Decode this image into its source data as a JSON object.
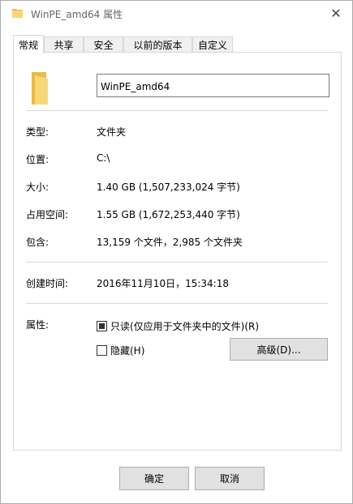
{
  "window": {
    "title": "WinPE_amd64 属性",
    "close_glyph": "✕"
  },
  "tabs": [
    {
      "label": "常规",
      "active": true
    },
    {
      "label": "共享",
      "active": false
    },
    {
      "label": "安全",
      "active": false
    },
    {
      "label": "以前的版本",
      "active": false
    },
    {
      "label": "自定义",
      "active": false
    }
  ],
  "general": {
    "folder_name": "WinPE_amd64",
    "type_label": "类型:",
    "type_value": "文件夹",
    "location_label": "位置:",
    "location_value": "C:\\",
    "size_label": "大小:",
    "size_value": "1.40 GB (1,507,233,024 字节)",
    "size_on_disk_label": "占用空间:",
    "size_on_disk_value": "1.55 GB (1,672,253,440 字节)",
    "contains_label": "包含:",
    "contains_value": "13,159 个文件，2,985 个文件夹",
    "created_label": "创建时间:",
    "created_value": "2016年11月10日，15:34:18",
    "attributes_label": "属性:",
    "readonly_label": "只读(仅应用于文件夹中的文件)(R)",
    "readonly_state": "indeterminate",
    "hidden_label": "隐藏(H)",
    "hidden_state": "unchecked",
    "advanced_button": "高级(D)..."
  },
  "footer": {
    "ok_button": "确定",
    "cancel_button": "取消"
  },
  "colors": {
    "folder_yellow": "#f8d775",
    "folder_shade": "#e9b949",
    "border": "#d9d9d9",
    "button_face": "#e1e1e1"
  }
}
